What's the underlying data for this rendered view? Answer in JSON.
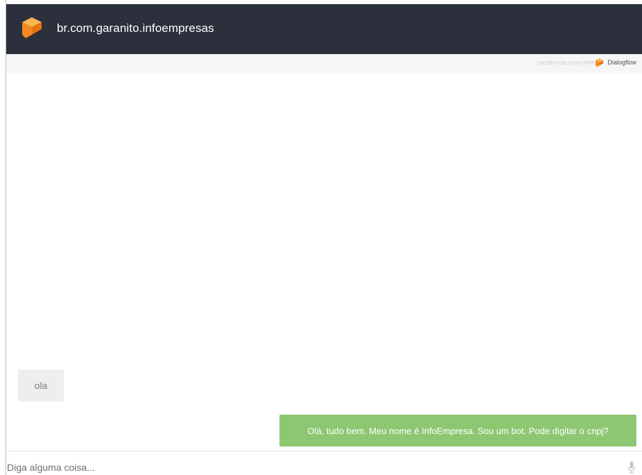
{
  "header": {
    "title": "br.com.garanito.infoempresas",
    "logo_icon": "cube-icon",
    "background": "#2b303c",
    "accent": "#f5a623"
  },
  "powered": {
    "label": "DESENVOLVIDO POR",
    "brand": "Dialogflow",
    "brand_icon": "dialogflow-logo-icon"
  },
  "messages": [
    {
      "from": "user",
      "text": "ola",
      "background": "#eeeeee"
    },
    {
      "from": "bot",
      "text": "Olá, tudo bem. Meu nome é InfoEmpresa. Sou um bot. Pode digitar o cnpj?",
      "background": "#8ec772"
    }
  ],
  "input": {
    "placeholder": "Diga alguma coisa...",
    "value": "",
    "mic_icon": "microphone-icon"
  }
}
